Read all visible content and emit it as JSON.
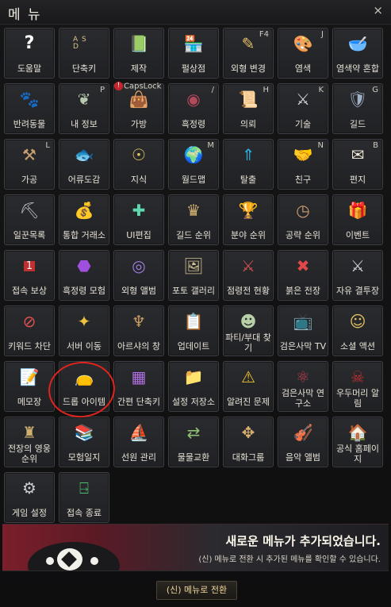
{
  "window": {
    "title": "메 뉴",
    "close": "×"
  },
  "tiles": [
    {
      "name": "help",
      "label": "도움말",
      "icon": "question-icon",
      "hotkey": ""
    },
    {
      "name": "shortcut-keys",
      "label": "단축키",
      "icon": "keyboard-icon",
      "hotkey": ""
    },
    {
      "name": "crafting",
      "label": "제작",
      "icon": "crafting-book-icon",
      "hotkey": ""
    },
    {
      "name": "pearl-shop",
      "label": "펄상점",
      "icon": "pearl-shop-icon",
      "hotkey": ""
    },
    {
      "name": "appearance-change",
      "label": "외형 변경",
      "icon": "comb-icon",
      "hotkey": "F4"
    },
    {
      "name": "dye",
      "label": "염색",
      "icon": "palette-icon",
      "hotkey": "J"
    },
    {
      "name": "dye-mix",
      "label": "염색약 혼합",
      "icon": "dye-bowl-icon",
      "hotkey": ""
    },
    {
      "name": "pets",
      "label": "반려동물",
      "icon": "paw-icon",
      "hotkey": ""
    },
    {
      "name": "my-info",
      "label": "내 정보",
      "icon": "feather-icon",
      "hotkey": "P"
    },
    {
      "name": "bag",
      "label": "가방",
      "icon": "bag-icon",
      "hotkey": "",
      "badge": "CapsLock"
    },
    {
      "name": "black-spirit",
      "label": "흑정령",
      "icon": "black-spirit-icon",
      "hotkey": "/"
    },
    {
      "name": "request",
      "label": "의뢰",
      "icon": "scroll-icon",
      "hotkey": "H"
    },
    {
      "name": "skills",
      "label": "기술",
      "icon": "crossed-axes-icon",
      "hotkey": "K"
    },
    {
      "name": "guild",
      "label": "길드",
      "icon": "shield-icon",
      "hotkey": "G"
    },
    {
      "name": "processing",
      "label": "가공",
      "icon": "hammer-icon",
      "hotkey": "L"
    },
    {
      "name": "fish-encyclopedia",
      "label": "어류도감",
      "icon": "fish-icon",
      "hotkey": ""
    },
    {
      "name": "knowledge",
      "label": "지식",
      "icon": "knowledge-head-icon",
      "hotkey": ""
    },
    {
      "name": "world-map",
      "label": "월드맵",
      "icon": "globe-icon",
      "hotkey": "M"
    },
    {
      "name": "escape",
      "label": "탈출",
      "icon": "escape-icon",
      "hotkey": ""
    },
    {
      "name": "friends",
      "label": "친구",
      "icon": "handshake-icon",
      "hotkey": "N"
    },
    {
      "name": "mail",
      "label": "편지",
      "icon": "envelope-icon",
      "hotkey": "B"
    },
    {
      "name": "worker-list",
      "label": "일꾼목록",
      "icon": "pickaxe-icon",
      "hotkey": ""
    },
    {
      "name": "central-market",
      "label": "통합 거래소",
      "icon": "money-bag-icon",
      "hotkey": ""
    },
    {
      "name": "ui-edit",
      "label": "UI편집",
      "icon": "move-arrows-icon",
      "hotkey": ""
    },
    {
      "name": "guild-ranking",
      "label": "길드 순위",
      "icon": "crown-medal-icon",
      "hotkey": ""
    },
    {
      "name": "field-ranking",
      "label": "분야 순위",
      "icon": "trophy-icon",
      "hotkey": ""
    },
    {
      "name": "attack-ranking",
      "label": "공략 순위",
      "icon": "clock-medal-icon",
      "hotkey": ""
    },
    {
      "name": "events",
      "label": "이벤트",
      "icon": "gift-icon",
      "hotkey": ""
    },
    {
      "name": "attendance-reward",
      "label": "접속 보상",
      "icon": "calendar-icon",
      "hotkey": ""
    },
    {
      "name": "black-spirit-adventure",
      "label": "흑정령 모험",
      "icon": "purple-orb-icon",
      "hotkey": ""
    },
    {
      "name": "appearance-album",
      "label": "외형 앨범",
      "icon": "camera-lens-icon",
      "hotkey": ""
    },
    {
      "name": "photo-gallery",
      "label": "포토 갤러리",
      "icon": "picture-icon",
      "hotkey": ""
    },
    {
      "name": "occupation-status",
      "label": "점령전 현황",
      "icon": "crossed-swords-shield-icon",
      "hotkey": ""
    },
    {
      "name": "red-battlefield",
      "label": "붉은 전장",
      "icon": "red-battle-icon",
      "hotkey": ""
    },
    {
      "name": "free-arena",
      "label": "자유 결투장",
      "icon": "dual-swords-icon",
      "hotkey": ""
    },
    {
      "name": "keyword-block",
      "label": "키워드 차단",
      "icon": "block-chat-icon",
      "hotkey": ""
    },
    {
      "name": "server-move",
      "label": "서버 이동",
      "icon": "server-sparkle-icon",
      "hotkey": ""
    },
    {
      "name": "arsha-window",
      "label": "아르샤의 창",
      "icon": "arsha-emblem-icon",
      "hotkey": ""
    },
    {
      "name": "update",
      "label": "업데이트",
      "icon": "notes-icon",
      "hotkey": ""
    },
    {
      "name": "party-find",
      "label": "파티/부대 찾기",
      "icon": "party-icon",
      "hotkey": ""
    },
    {
      "name": "black-desert-tv",
      "label": "검은사막 TV",
      "icon": "tv-icon",
      "hotkey": ""
    },
    {
      "name": "social-action",
      "label": "소셜 액션",
      "icon": "smile-icon",
      "hotkey": ""
    },
    {
      "name": "memo",
      "label": "메모장",
      "icon": "memo-icon",
      "hotkey": ""
    },
    {
      "name": "drop-item",
      "label": "드롭 아이템",
      "icon": "pouch-icon",
      "hotkey": ""
    },
    {
      "name": "simple-shortcut",
      "label": "간편 단축키",
      "icon": "grid-shortcut-icon",
      "hotkey": ""
    },
    {
      "name": "settings-storage",
      "label": "설정 저장소",
      "icon": "folder-gear-icon",
      "hotkey": ""
    },
    {
      "name": "known-issues",
      "label": "알려진 문제",
      "icon": "warning-icon",
      "hotkey": ""
    },
    {
      "name": "research-lab",
      "label": "검은사막 연구소",
      "icon": "research-orbit-icon",
      "hotkey": ""
    },
    {
      "name": "ugudeuri-alert",
      "label": "우두머리 알림",
      "icon": "boss-skull-icon",
      "hotkey": ""
    },
    {
      "name": "battlefield-hero-ranking",
      "label": "전장의 영웅 순위",
      "icon": "horned-helmet-icon",
      "hotkey": ""
    },
    {
      "name": "adventure-log",
      "label": "모험일지",
      "icon": "books-icon",
      "hotkey": ""
    },
    {
      "name": "sailor-management",
      "label": "선원 관리",
      "icon": "sailor-hat-icon",
      "hotkey": ""
    },
    {
      "name": "barter",
      "label": "물물교환",
      "icon": "barter-icon",
      "hotkey": ""
    },
    {
      "name": "group-chat",
      "label": "대화그룹",
      "icon": "group-chat-icon",
      "hotkey": ""
    },
    {
      "name": "music-album",
      "label": "음악 앨범",
      "icon": "violin-icon",
      "hotkey": ""
    },
    {
      "name": "official-homepage",
      "label": "공식 홈페이지",
      "icon": "home-window-icon",
      "hotkey": ""
    },
    {
      "name": "game-settings",
      "label": "게임 설정",
      "icon": "gear-icon",
      "hotkey": ""
    },
    {
      "name": "exit-game",
      "label": "접속 종료",
      "icon": "exit-door-icon",
      "hotkey": ""
    }
  ],
  "banner": {
    "title": "새로운 메뉴가 추가되었습니다.",
    "subtitle": "(신) 메뉴로 전환 시 추가된 메뉴를 확인할 수 있습니다."
  },
  "switch_button": "(신) 메뉴로 전환",
  "colors": {
    "accent": "#f0d79a",
    "banner_red": "#7a1f2b",
    "highlight_circle": "#e0241d"
  }
}
